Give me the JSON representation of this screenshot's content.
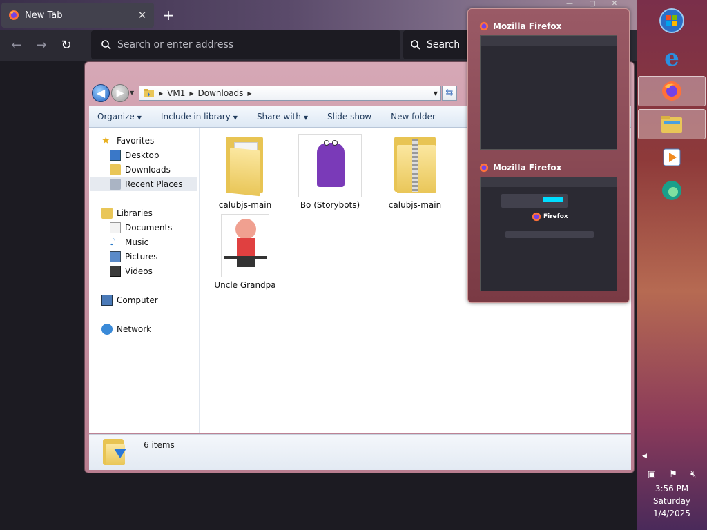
{
  "firefox": {
    "tab_title": "New Tab",
    "tab_close": "✕",
    "new_tab": "+",
    "address_placeholder": "Search or enter address",
    "search_label": "Search"
  },
  "explorer": {
    "address": {
      "segments": [
        "VM1",
        "Downloads"
      ]
    },
    "toolbar": {
      "organize": "Organize",
      "include_in_library": "Include in library",
      "share_with": "Share with",
      "slide_show": "Slide show",
      "new_folder": "New folder"
    },
    "nav": {
      "favorites": "Favorites",
      "desktop": "Desktop",
      "downloads": "Downloads",
      "recent_places": "Recent Places",
      "libraries": "Libraries",
      "documents": "Documents",
      "music": "Music",
      "pictures": "Pictures",
      "videos": "Videos",
      "computer": "Computer",
      "network": "Network"
    },
    "files": [
      {
        "name": "calubjs-main",
        "icon": "folder-icon"
      },
      {
        "name": "Bo (Storybots)",
        "icon": "image-thumbnail"
      },
      {
        "name": "calubjs-main",
        "icon": "zip-folder-icon"
      },
      {
        "name": "Uncle Grandpa",
        "icon": "image-thumbnail"
      }
    ],
    "status": {
      "item_count": "6 items"
    }
  },
  "popup": {
    "previews": [
      {
        "title": "Mozilla Firefox"
      },
      {
        "title": "Mozilla Firefox",
        "brand": "Firefox"
      }
    ]
  },
  "tray": {
    "time": "3:56 PM",
    "day": "Saturday",
    "date": "1/4/2025"
  },
  "colors": {
    "firefox_dark": "#1c1b22",
    "firefox_toolbar": "#2b2a33",
    "explorer_toolbar_text": "#1e395b",
    "popup_bg": "#8a4a55",
    "taskbar": "#8e3a3a"
  }
}
